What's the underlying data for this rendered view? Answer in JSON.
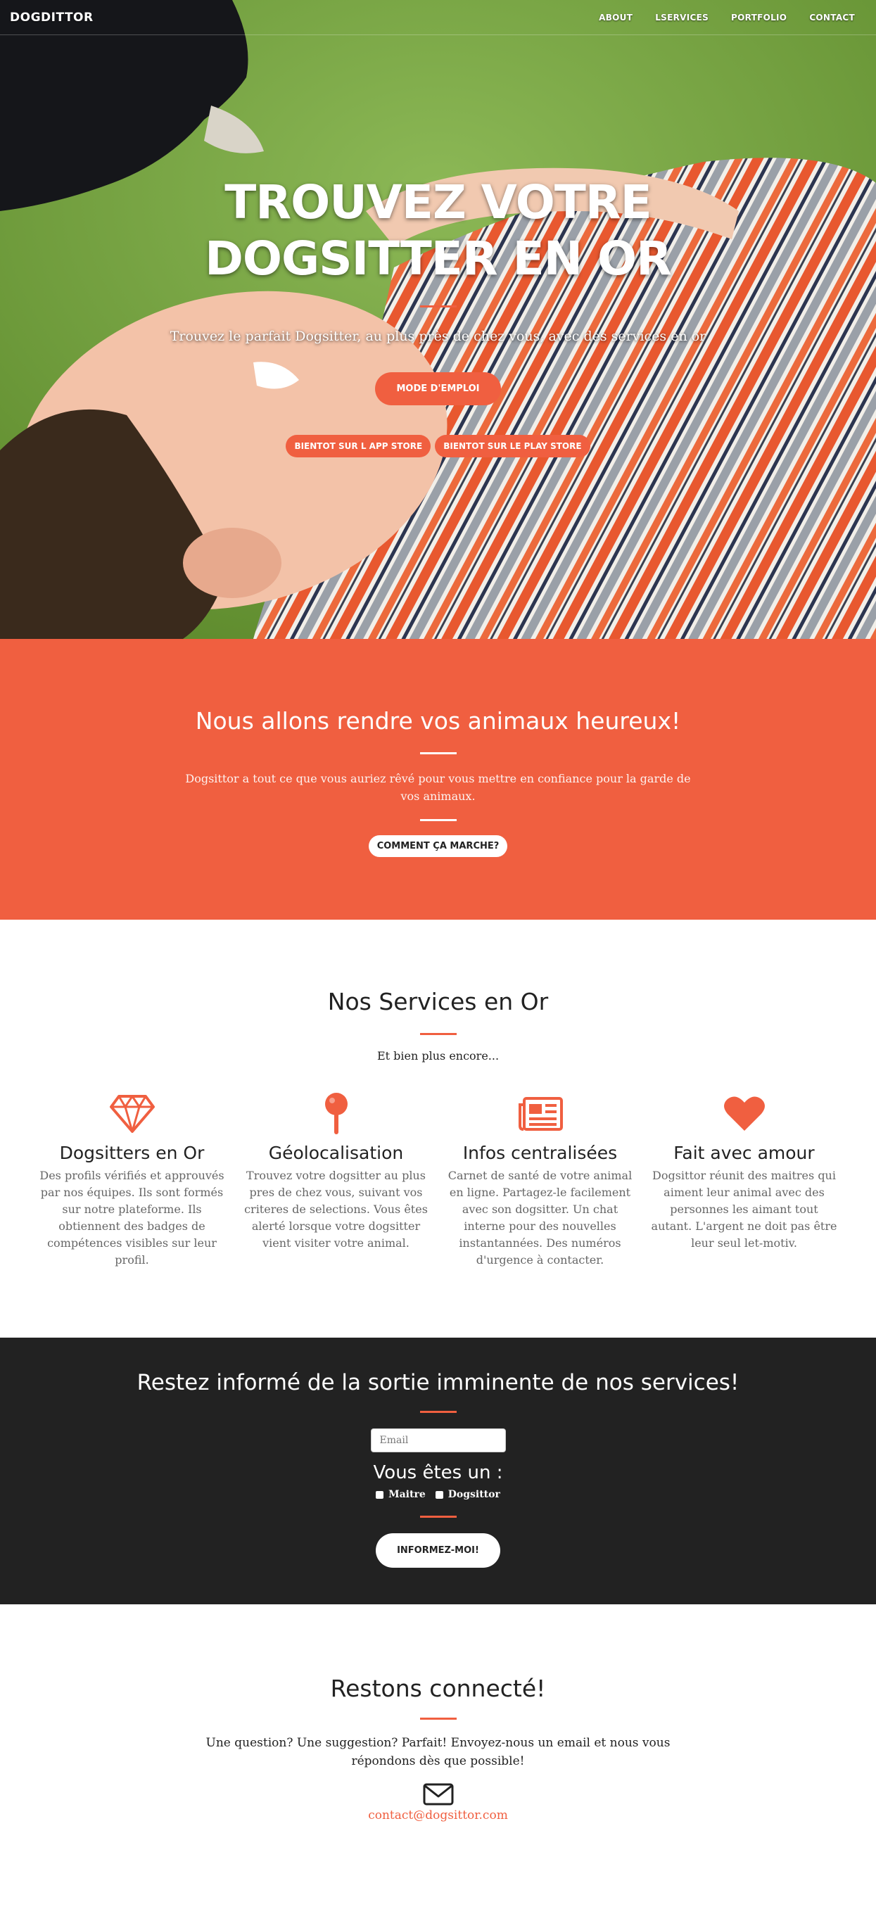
{
  "nav": {
    "brand": "DOGDITTOR",
    "links": [
      "ABOUT",
      "LSERVICES",
      "PORTFOLIO",
      "CONTACT"
    ]
  },
  "hero": {
    "title": "TROUVEZ VOTRE DOGSITTER EN OR",
    "subtitle": "Trouvez le parfait Dogsitter, au plus près de chez vous, avec des services en or",
    "mode_button": "MODE D'EMPLOI",
    "app_store_button": "BIENTOT SUR L APP STORE",
    "play_store_button": "BIENTOT SUR LE PLAY STORE"
  },
  "about": {
    "title": "Nous allons rendre vos animaux heureux!",
    "text": "Dogsittor a tout ce que vous auriez rêvé pour vous mettre en confiance pour la garde de vos animaux.",
    "button": "COMMENT ÇA MARCHE?"
  },
  "services": {
    "title": "Nos Services en Or",
    "subtitle": "Et bien plus encore...",
    "items": [
      {
        "icon": "diamond-icon",
        "title": "Dogsitters en Or",
        "text": "Des profils vérifiés et approuvés par nos équipes. Ils sont formés sur notre plateforme. Ils obtiennent des badges de compétences visibles sur leur profil."
      },
      {
        "icon": "map-pin-icon",
        "title": "Géolocalisation",
        "text": "Trouvez votre dogsitter au plus pres de chez vous, suivant vos criteres de selections. Vous êtes alerté lorsque votre dogsitter vient visiter votre animal."
      },
      {
        "icon": "newspaper-icon",
        "title": "Infos centralisées",
        "text": "Carnet de santé de votre animal en ligne. Partagez-le facilement avec son dogsitter. Un chat interne pour des nouvelles instantannées. Des numéros d'urgence à contacter."
      },
      {
        "icon": "heart-icon",
        "title": "Fait avec amour",
        "text": "Dogsittor réunit des maitres qui aiment leur animal avec des personnes les aimant tout autant. L'argent ne doit pas être leur seul let-motiv."
      }
    ]
  },
  "newsletter": {
    "title": "Restez informé de la sortie imminente de nos services!",
    "email_placeholder": "Email",
    "role_title": "Vous êtes un :",
    "option_1": "Maitre",
    "option_2": "Dogsittor",
    "button": "INFORMEZ-MOI!"
  },
  "contact": {
    "title": "Restons connecté!",
    "text": "Une question? Une suggestion? Parfait! Envoyez-nous un email et nous vous répondons dès que possible!",
    "email": "contact@dogsittor.com"
  },
  "colors": {
    "accent": "#f05f40",
    "dark": "#222222"
  }
}
